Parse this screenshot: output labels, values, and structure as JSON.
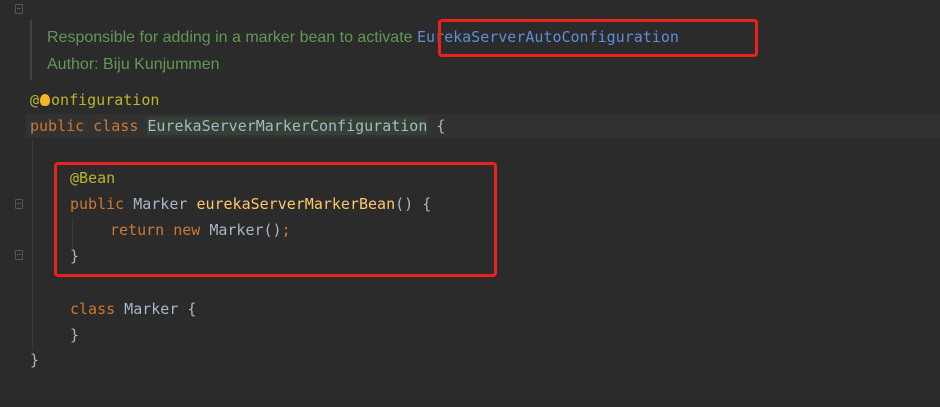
{
  "doc": {
    "line1_text": "Responsible for adding in a marker bean to activate ",
    "line1_link": "EurekaServerAutoConfiguration",
    "line2_text": "Author: Biju Kunjummen"
  },
  "code": {
    "l1_at": "@",
    "l1_rest": "onfiguration",
    "l2_kw1": "public",
    "l2_kw2": "class",
    "l2_class": "EurekaServerMarkerConfiguration",
    "l2_brace": " {",
    "l3_ann": "@Bean",
    "l4_kw": "public",
    "l4_type": " Marker ",
    "l4_fn": "eurekaServerMarkerBean",
    "l4_rest": "() {",
    "l5_kw1": "return",
    "l5_kw2": "new",
    "l5_rest": " Marker()",
    "l5_semi": ";",
    "l6_brace": "}",
    "l7_kw": "class",
    "l7_rest": " Marker {",
    "l8_brace": "}",
    "l9_brace": "}"
  },
  "colors": {
    "keyword": "#cc7832",
    "annotation": "#bbb529",
    "method": "#ffc66d",
    "doc_comment": "#629755",
    "doc_link": "#5c8fd6",
    "highlight_box": "#e8231e"
  },
  "icons": [
    "fold-marker-icon",
    "intention-bulb-icon"
  ]
}
